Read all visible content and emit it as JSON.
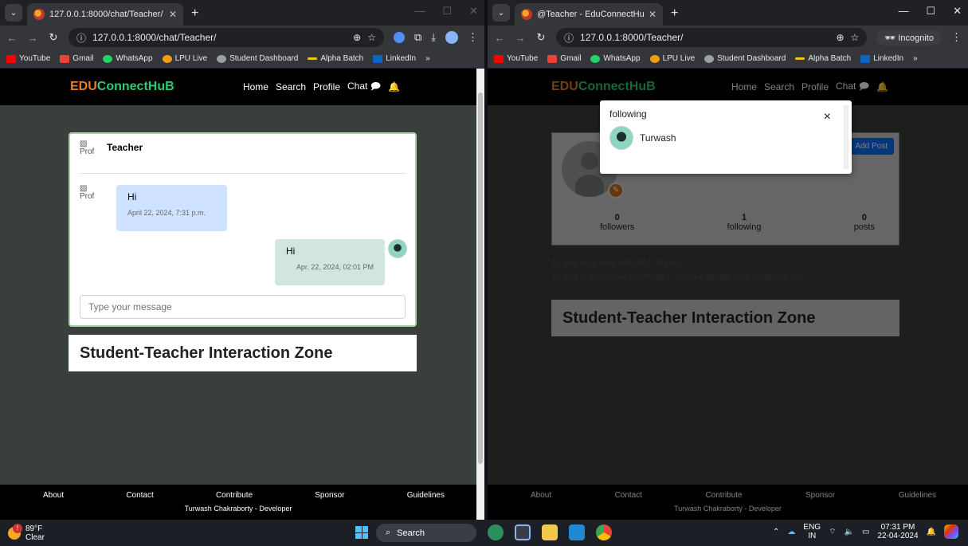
{
  "left_window": {
    "tab_title": "127.0.0.1:8000/chat/Teacher/",
    "url": "127.0.0.1:8000/chat/Teacher/",
    "bookmarks": [
      "YouTube",
      "Gmail",
      "WhatsApp",
      "LPU Live",
      "Student Dashboard",
      "Alpha Batch",
      "LinkedIn"
    ],
    "bookmarks_more": "»"
  },
  "right_window": {
    "tab_title": "@Teacher - EduConnectHub",
    "url": "127.0.0.1:8000/Teacher/",
    "incognito_label": "Incognito",
    "bookmarks": [
      "YouTube",
      "Gmail",
      "WhatsApp",
      "LPU Live",
      "Student Dashboard",
      "Alpha Batch",
      "LinkedIn"
    ],
    "bookmarks_more": "»"
  },
  "site": {
    "brand_prefix": "EDU",
    "brand_rest": "ConnectHuB",
    "nav": [
      "Home",
      "Search",
      "Profile",
      "Chat"
    ],
    "zone_title": "Student-Teacher Interaction Zone",
    "footer_links": [
      "About",
      "Contact",
      "Contribute",
      "Sponsor",
      "Guidelines"
    ],
    "footer_dev": "Turwash Chakraborty - Developer"
  },
  "chat": {
    "broken_img_alt": "Prof",
    "contact_name": "Teacher",
    "messages": [
      {
        "text": "Hi",
        "time": "April 22, 2024, 7:31 p.m.",
        "direction": "in"
      },
      {
        "text": "Hi",
        "time": "Apr. 22, 2024, 02:01 PM",
        "direction": "out"
      }
    ],
    "input_placeholder": "Type your message"
  },
  "profile": {
    "add_post_label": "Add Post",
    "stats": [
      {
        "value": "0",
        "label": "followers"
      },
      {
        "value": "1",
        "label": "following"
      },
      {
        "value": "0",
        "label": "posts"
      }
    ],
    "hint1": "To add post click Add Post button.",
    "hint2": "To add or edit more information on your profile click on pencil icon."
  },
  "modal": {
    "title": "following",
    "close": "×",
    "users": [
      "Turwash"
    ]
  },
  "taskbar": {
    "temp": "89°F",
    "condition": "Clear",
    "search": "Search",
    "lang1": "ENG",
    "lang2": "IN",
    "time": "07:31 PM",
    "date": "22-04-2024"
  }
}
